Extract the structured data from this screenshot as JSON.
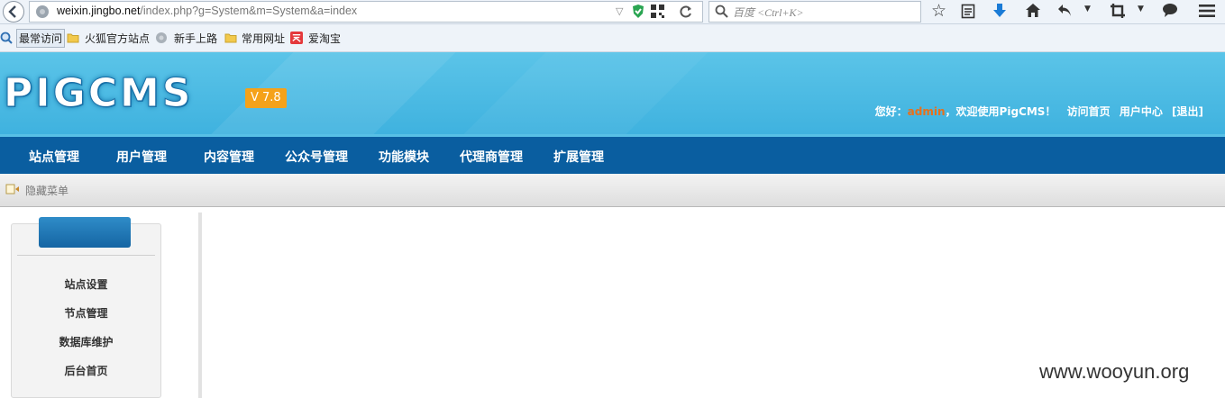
{
  "browser": {
    "url_host": "weixin.jingbo.net",
    "url_path": "/index.php?g=System&m=System&a=index",
    "search_placeholder": "百度 <Ctrl+K>",
    "bookmarks": [
      "最常访问",
      "火狐官方站点",
      "新手上路",
      "常用网址",
      "爱淘宝"
    ]
  },
  "header": {
    "logo": "PIGCMS",
    "version": "V 7.8",
    "greeting": "您好：",
    "username": "admin",
    "welcome": "，欢迎使用PigCMS！",
    "links": [
      "访问首页",
      "用户中心",
      "[退出]"
    ]
  },
  "nav": {
    "items": [
      "站点管理",
      "用户管理",
      "内容管理",
      "公众号管理",
      "功能模块",
      "代理商管理",
      "扩展管理"
    ]
  },
  "crumb": {
    "toggle_label": "隐藏菜单"
  },
  "sidebar": {
    "items": [
      "站点设置",
      "节点管理",
      "数据库维护",
      "后台首页"
    ]
  },
  "watermark": "www.wooyun.org",
  "colors": {
    "nav_bg": "#0a5ea0",
    "header_bg": "#3fb2df",
    "username": "#e8701a",
    "version_badge": "#f5a21a"
  }
}
